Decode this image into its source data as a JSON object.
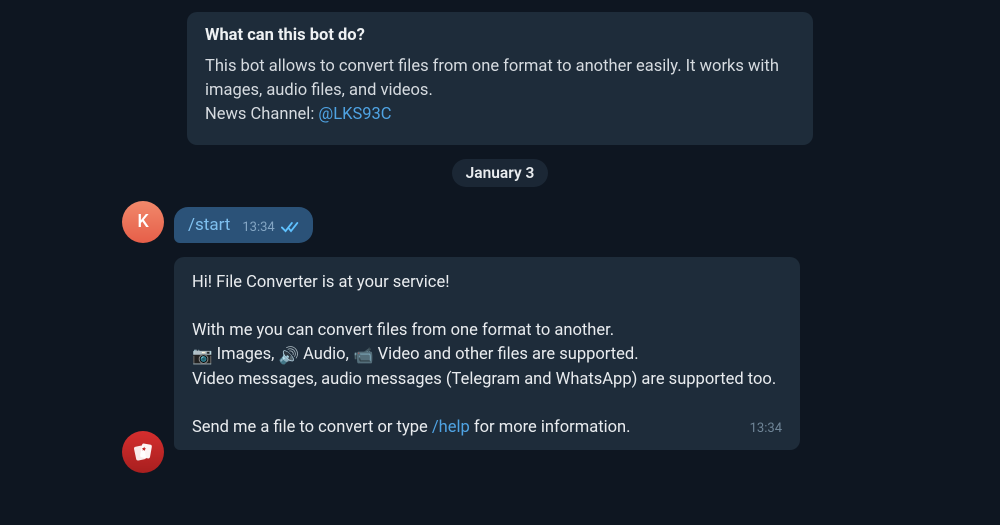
{
  "info": {
    "title": "What can this bot do?",
    "desc_line1": "This bot allows to convert files from one format to another easily. It works with images, audio files, and videos.",
    "news_prefix": "News Channel: ",
    "news_link": "@LKS93C"
  },
  "date": "January 3",
  "user": {
    "avatar_letter": "K",
    "command": "/start",
    "time": "13:34"
  },
  "bot": {
    "greeting": "Hi! File Converter is at your service!",
    "line1": "With me you can convert files from one format to another.",
    "line2_pre": "📷 Images, 🔊 Audio, 📹 Video and other files are supported.",
    "line3": "Video messages, audio messages (Telegram and WhatsApp) are supported too.",
    "send_prefix": "Send me a file to convert or type ",
    "help_cmd": "/help",
    "send_suffix": " for more information.",
    "time": "13:34"
  }
}
